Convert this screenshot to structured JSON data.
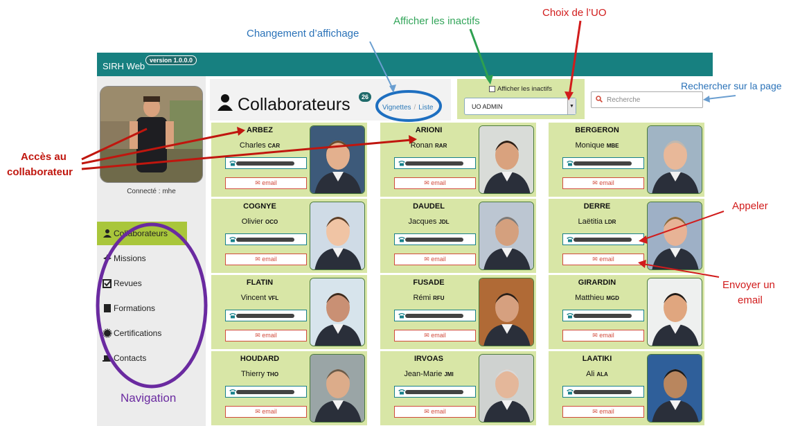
{
  "app": {
    "title": "SIRH Web",
    "version": "version 1.0.0.0"
  },
  "sidebar": {
    "connected": "Connecté : mhe",
    "items": [
      {
        "label": "Collaborateurs",
        "icon": "user-icon",
        "active": true
      },
      {
        "label": "Missions",
        "icon": "crosshair-icon",
        "active": false
      },
      {
        "label": "Revues",
        "icon": "checkbox-icon",
        "active": false
      },
      {
        "label": "Formations",
        "icon": "book-icon",
        "active": false
      },
      {
        "label": "Certifications",
        "icon": "certificate-icon",
        "active": false
      },
      {
        "label": "Contacts",
        "icon": "laptop-icon",
        "active": false
      }
    ]
  },
  "header": {
    "title": "Collaborateurs",
    "count": "26",
    "view_thumbnails": "Vignettes",
    "view_separator": "/",
    "view_list": "Liste",
    "inactive_label": "Afficher les inactifs",
    "uo_selected": "UO ADMIN",
    "search_placeholder": "Recherche"
  },
  "cards": [
    {
      "last": "ARBEZ",
      "first": "Charles",
      "initials": "CAR",
      "email": "email"
    },
    {
      "last": "ARIONI",
      "first": "Ronan",
      "initials": "RAR",
      "email": "email"
    },
    {
      "last": "BERGERON",
      "first": "Monique",
      "initials": "MBE",
      "email": "email"
    },
    {
      "last": "COGNYE",
      "first": "Olivier",
      "initials": "OCO",
      "email": "email"
    },
    {
      "last": "DAUDEL",
      "first": "Jacques",
      "initials": "JDL",
      "email": "email"
    },
    {
      "last": "DERRE",
      "first": "Laëtitia",
      "initials": "LDR",
      "email": "email"
    },
    {
      "last": "FLATIN",
      "first": "Vincent",
      "initials": "VFL",
      "email": "email"
    },
    {
      "last": "FUSADE",
      "first": "Rémi",
      "initials": "RFU",
      "email": "email"
    },
    {
      "last": "GIRARDIN",
      "first": "Matthieu",
      "initials": "MGD",
      "email": "email"
    },
    {
      "last": "HOUDARD",
      "first": "Thierry",
      "initials": "THO",
      "email": "email"
    },
    {
      "last": "IRVOAS",
      "first": "Jean-Marie",
      "initials": "JMI",
      "email": "email"
    },
    {
      "last": "LAATIKI",
      "first": "Ali",
      "initials": "ALA",
      "email": "email"
    }
  ],
  "annotations": {
    "view_change": "Changement d’affichage",
    "show_inactive": "Afficher les inactifs",
    "uo_choice": "Choix de l’UO",
    "search_page": "Rechercher sur la page",
    "access_line1": "Accès au",
    "access_line2": "collaborateur",
    "call": "Appeler",
    "send_line1": "Envoyer un",
    "send_line2": "email",
    "navigation": "Navigation"
  },
  "colors": {
    "topbar": "#178080",
    "accent_green": "#a9c63b",
    "card_bg": "#d8e6a6",
    "email_red": "#d14b3c"
  }
}
